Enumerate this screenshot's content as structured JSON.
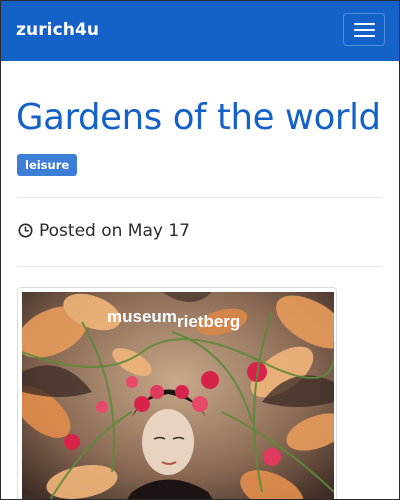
{
  "navbar": {
    "brand": "zurich4u",
    "menu_icon": "hamburger-menu-icon",
    "background": "#1461c7"
  },
  "post": {
    "title": "Gardens of the world",
    "tag": "leisure",
    "posted_label": "Posted on May 17",
    "posted_icon": "clock-icon"
  },
  "image": {
    "overlay_text_1": "museum",
    "overlay_text_2": "rietberg"
  },
  "colors": {
    "accent": "#1461c7",
    "tag": "#3d7ed6",
    "text": "#2b2b2b"
  }
}
